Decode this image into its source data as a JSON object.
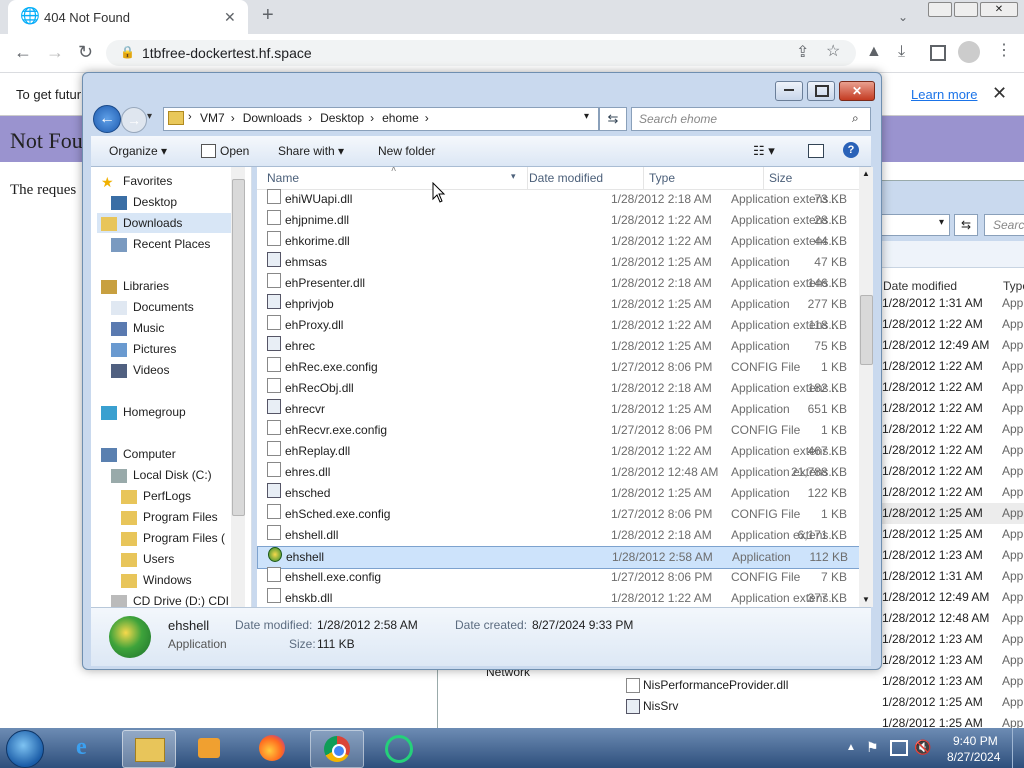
{
  "browser": {
    "tab_title": "404 Not Found",
    "url": "1tbfree-dockertest.hf.space",
    "infobar_text": "To get futur",
    "learn_more": "Learn more",
    "page_heading": "Not Fou",
    "page_text": "The reques"
  },
  "dialog": {
    "breadcrumb": [
      "VM7",
      "Downloads",
      "Desktop",
      "ehome"
    ],
    "search_placeholder": "Search ehome",
    "toolbar": {
      "organize": "Organize",
      "open": "Open",
      "share_with": "Share with",
      "new_folder": "New folder"
    },
    "nav": [
      {
        "label": "Favorites",
        "icon": "star-icon",
        "indent": 0,
        "top": 0
      },
      {
        "label": "Desktop",
        "icon": "desktop-icon",
        "indent": 1
      },
      {
        "label": "Downloads",
        "icon": "folder-icon",
        "indent": 1,
        "selected": true
      },
      {
        "label": "Recent Places",
        "icon": "recent-icon",
        "indent": 1
      },
      {
        "label": "Libraries",
        "icon": "library-icon",
        "indent": 0,
        "gap": true
      },
      {
        "label": "Documents",
        "icon": "document-icon",
        "indent": 1
      },
      {
        "label": "Music",
        "icon": "music-icon",
        "indent": 1
      },
      {
        "label": "Pictures",
        "icon": "picture-icon",
        "indent": 1
      },
      {
        "label": "Videos",
        "icon": "video-icon",
        "indent": 1
      },
      {
        "label": "Homegroup",
        "icon": "homegroup-icon",
        "indent": 0,
        "gap": true
      },
      {
        "label": "Computer",
        "icon": "computer-icon",
        "indent": 0,
        "gap": true
      },
      {
        "label": "Local Disk (C:)",
        "icon": "disk-icon",
        "indent": 1
      },
      {
        "label": "PerfLogs",
        "icon": "folder-icon",
        "indent": 2
      },
      {
        "label": "Program Files",
        "icon": "folder-icon",
        "indent": 2
      },
      {
        "label": "Program Files (",
        "icon": "folder-icon",
        "indent": 2
      },
      {
        "label": "Users",
        "icon": "folder-icon",
        "indent": 2
      },
      {
        "label": "Windows",
        "icon": "folder-icon",
        "indent": 2
      },
      {
        "label": "CD Drive (D:) CDI",
        "icon": "cd-icon",
        "indent": 1
      }
    ],
    "columns": {
      "name": "Name",
      "date": "Date modified",
      "type": "Type",
      "size": "Size"
    },
    "files": [
      {
        "name": "ehiWUapi.dll",
        "date": "1/28/2012 2:18 AM",
        "type": "Application extens...",
        "size": "73 KB",
        "kind": "dll"
      },
      {
        "name": "ehjpnime.dll",
        "date": "1/28/2012 1:22 AM",
        "type": "Application extens...",
        "size": "28 KB",
        "kind": "dll"
      },
      {
        "name": "ehkorime.dll",
        "date": "1/28/2012 1:22 AM",
        "type": "Application extens...",
        "size": "44 KB",
        "kind": "dll"
      },
      {
        "name": "ehmsas",
        "date": "1/28/2012 1:25 AM",
        "type": "Application",
        "size": "47 KB",
        "kind": "app"
      },
      {
        "name": "ehPresenter.dll",
        "date": "1/28/2012 2:18 AM",
        "type": "Application extens...",
        "size": "146 KB",
        "kind": "dll"
      },
      {
        "name": "ehprivjob",
        "date": "1/28/2012 1:25 AM",
        "type": "Application",
        "size": "277 KB",
        "kind": "app"
      },
      {
        "name": "ehProxy.dll",
        "date": "1/28/2012 1:22 AM",
        "type": "Application extens...",
        "size": "118 KB",
        "kind": "dll"
      },
      {
        "name": "ehrec",
        "date": "1/28/2012 1:25 AM",
        "type": "Application",
        "size": "75 KB",
        "kind": "app"
      },
      {
        "name": "ehRec.exe.config",
        "date": "1/27/2012 8:06 PM",
        "type": "CONFIG File",
        "size": "1 KB",
        "kind": "cfg"
      },
      {
        "name": "ehRecObj.dll",
        "date": "1/28/2012 2:18 AM",
        "type": "Application extens...",
        "size": "182 KB",
        "kind": "dll"
      },
      {
        "name": "ehrecvr",
        "date": "1/28/2012 1:25 AM",
        "type": "Application",
        "size": "651 KB",
        "kind": "app"
      },
      {
        "name": "ehRecvr.exe.config",
        "date": "1/27/2012 8:06 PM",
        "type": "CONFIG File",
        "size": "1 KB",
        "kind": "cfg"
      },
      {
        "name": "ehReplay.dll",
        "date": "1/28/2012 1:22 AM",
        "type": "Application extens...",
        "size": "467 KB",
        "kind": "dll"
      },
      {
        "name": "ehres.dll",
        "date": "1/28/2012 12:48 AM",
        "type": "Application extens...",
        "size": "21,788 KB",
        "kind": "dll"
      },
      {
        "name": "ehsched",
        "date": "1/28/2012 1:25 AM",
        "type": "Application",
        "size": "122 KB",
        "kind": "app"
      },
      {
        "name": "ehSched.exe.config",
        "date": "1/27/2012 8:06 PM",
        "type": "CONFIG File",
        "size": "1 KB",
        "kind": "cfg"
      },
      {
        "name": "ehshell.dll",
        "date": "1/28/2012 2:18 AM",
        "type": "Application extens...",
        "size": "6,171 KB",
        "kind": "dll"
      },
      {
        "name": "ehshell",
        "date": "1/28/2012 2:58 AM",
        "type": "Application",
        "size": "112 KB",
        "kind": "ehshell",
        "selected": true
      },
      {
        "name": "ehshell.exe.config",
        "date": "1/27/2012 8:06 PM",
        "type": "CONFIG File",
        "size": "7 KB",
        "kind": "cfg"
      },
      {
        "name": "ehskb.dll",
        "date": "1/28/2012 1:22 AM",
        "type": "Application extens...",
        "size": "377 KB",
        "kind": "dll"
      }
    ],
    "details": {
      "name": "ehshell",
      "type": "Application",
      "date_modified_label": "Date modified:",
      "date_modified": "1/28/2012 2:58 AM",
      "date_created_label": "Date created:",
      "date_created": "8/27/2024 9:33 PM",
      "size_label": "Size:",
      "size": "111 KB"
    }
  },
  "bg_explorer": {
    "search_placeholder": "Searc",
    "col_date": "Date modified",
    "col_type": "Type",
    "dates": [
      "1/28/2012 1:31 AM",
      "1/28/2012 1:22 AM",
      "1/28/2012 12:49 AM",
      "1/28/2012 1:22 AM",
      "1/28/2012 1:22 AM",
      "1/28/2012 1:22 AM",
      "1/28/2012 1:22 AM",
      "1/28/2012 1:22 AM",
      "1/28/2012 1:22 AM",
      "1/28/2012 1:22 AM",
      "1/28/2012 1:25 AM",
      "1/28/2012 1:25 AM",
      "1/28/2012 1:23 AM",
      "1/28/2012 1:31 AM",
      "1/28/2012 12:49 AM",
      "1/28/2012 12:48 AM",
      "1/28/2012 1:23 AM",
      "1/28/2012 1:23 AM",
      "1/28/2012 1:23 AM",
      "1/28/2012 1:25 AM",
      "1/28/2012 1:25 AM"
    ],
    "type_text": "App",
    "network_label": "Network",
    "file1": "NisPerformanceProvider.dll",
    "file2": "NisSrv"
  },
  "taskbar": {
    "time": "9:40 PM",
    "date": "8/27/2024"
  }
}
